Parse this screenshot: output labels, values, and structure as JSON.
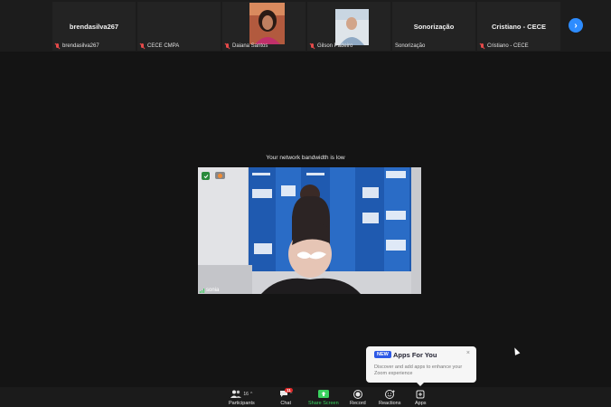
{
  "gallery": {
    "tiles": [
      {
        "big_name": "brendasilva267",
        "label": "brendasilva267",
        "muted": true
      },
      {
        "big_name": "",
        "label": "CECE CMPA",
        "muted": true
      },
      {
        "big_name": "",
        "label": "Daiana Santos",
        "muted": true
      },
      {
        "big_name": "",
        "label": "Gilson Padeiro",
        "muted": true
      },
      {
        "big_name": "Sonorização",
        "label": "Sonorização",
        "muted": false
      },
      {
        "big_name": "Cristiano - CECE",
        "label": "Cristiano - CECE",
        "muted": true
      }
    ],
    "next_glyph": "›"
  },
  "notice": {
    "bandwidth": "Your network bandwidth is low"
  },
  "main_video": {
    "speaker": "sonia"
  },
  "apps_popup": {
    "badge": "NEW",
    "title": "Apps For You",
    "close_glyph": "×",
    "description": "Discover and add apps to enhance your Zoom experience"
  },
  "toolbar": {
    "participants_label": "Participants",
    "participants_count": "16",
    "chat_label": "Chat",
    "chat_badge": "11",
    "share_label": "Share Screen",
    "record_label": "Record",
    "reactions_label": "Reactions",
    "apps_label": "Apps"
  },
  "colors": {
    "share_green": "#3ad25f",
    "accent_blue": "#2d8cff",
    "muted_red": "#e84a4a"
  }
}
